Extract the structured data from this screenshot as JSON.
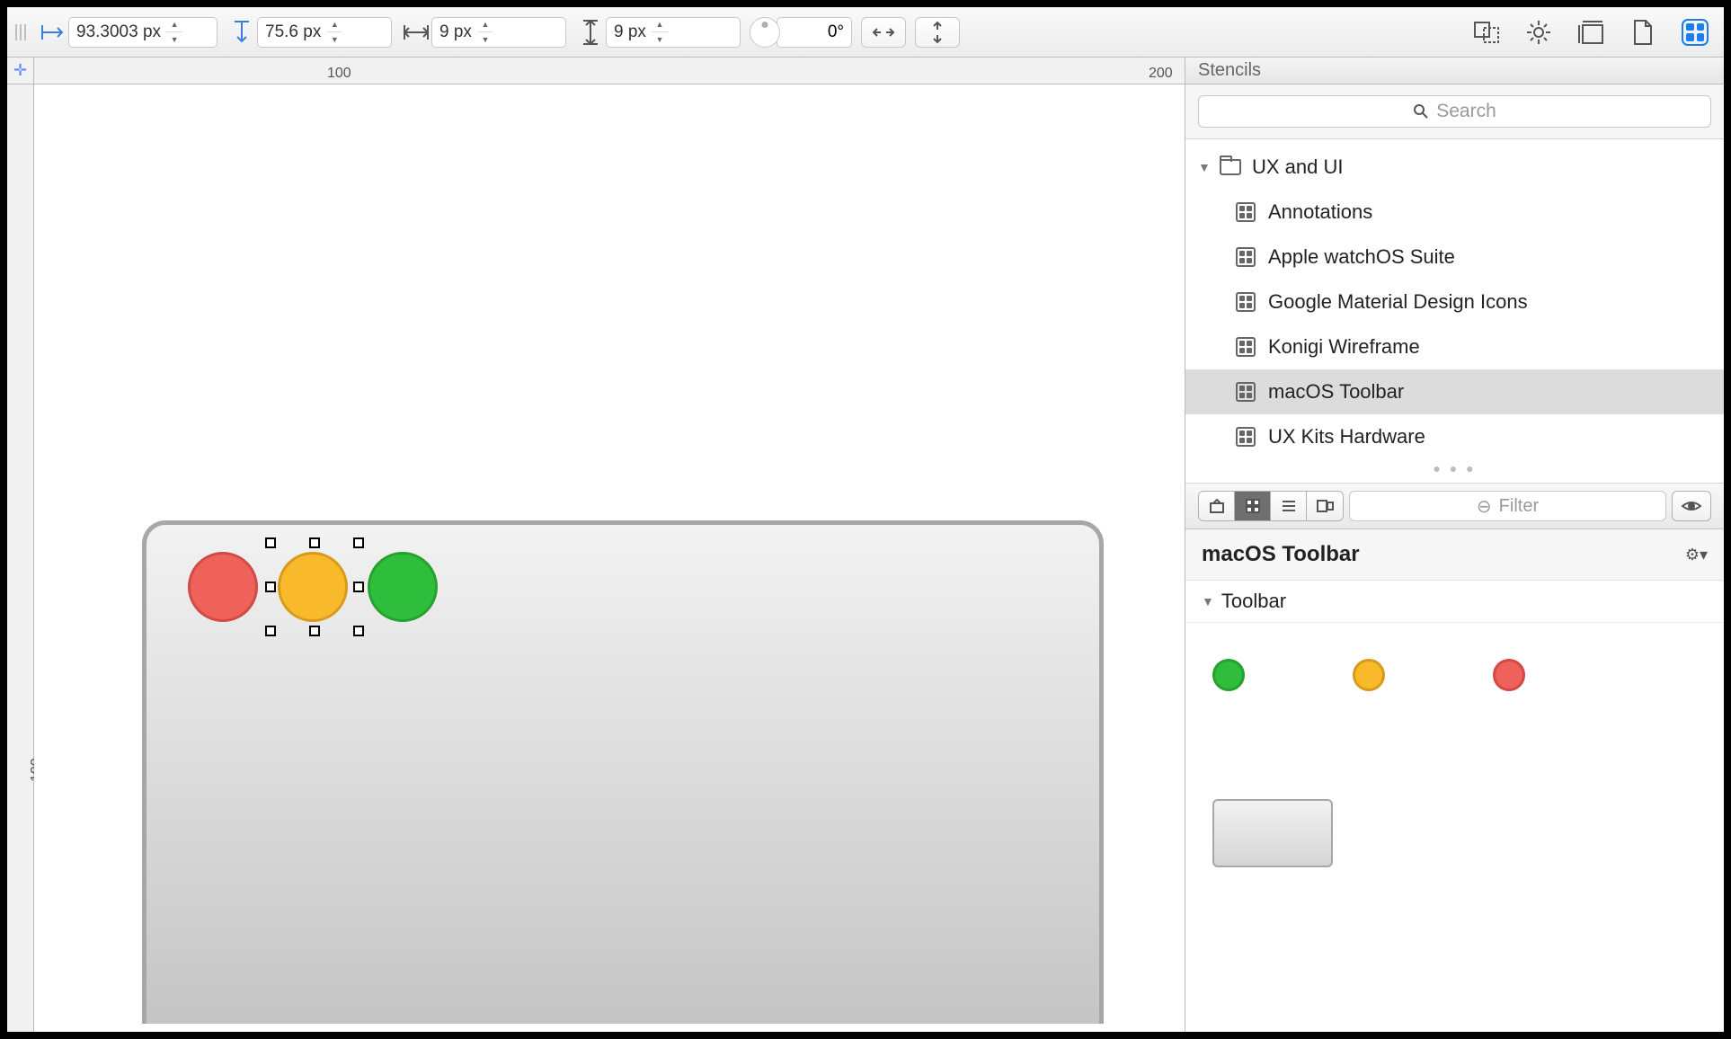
{
  "toolbar": {
    "x_value": "93.3003 px",
    "y_value": "75.6 px",
    "w_value": "9 px",
    "h_value": "9 px",
    "rotation": "0°"
  },
  "ruler": {
    "h_ticks": [
      "100",
      "200"
    ],
    "v_ticks": [
      "100"
    ]
  },
  "sidebar": {
    "title": "Stencils",
    "search_placeholder": "Search",
    "folder_name": "UX and UI",
    "items": [
      "Annotations",
      "Apple watchOS Suite",
      "Google Material Design Icons",
      "Konigi Wireframe",
      "macOS Toolbar",
      "UX Kits Hardware"
    ],
    "selected_index": 4,
    "filter_placeholder": "Filter",
    "stencil_title": "macOS Toolbar",
    "section_name": "Toolbar"
  },
  "colors": {
    "red": "#ee625a",
    "yellow": "#f8b92a",
    "green": "#2fbd3c",
    "accent": "#1a7df0"
  }
}
